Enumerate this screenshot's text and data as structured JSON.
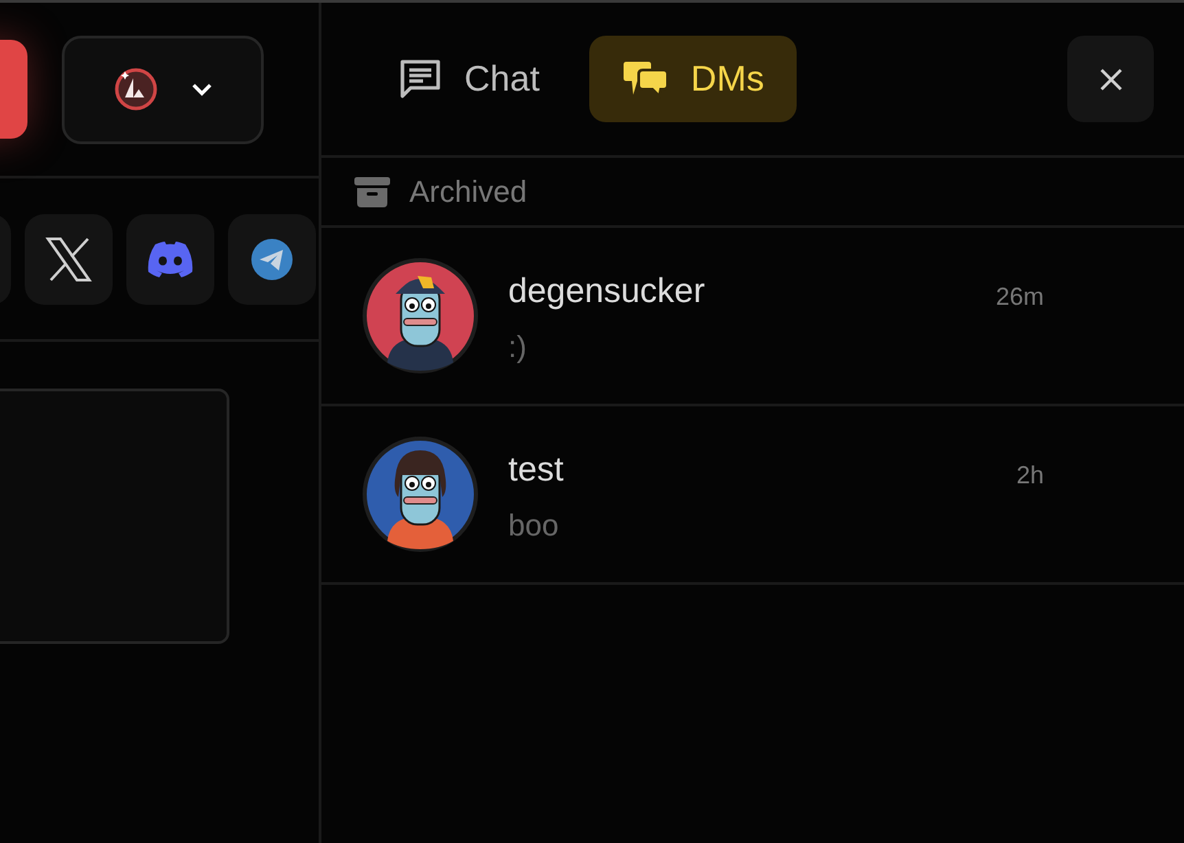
{
  "network_selector": {
    "expanded": false
  },
  "social_links": [
    {
      "kind": "other"
    },
    {
      "kind": "x"
    },
    {
      "kind": "discord"
    },
    {
      "kind": "telegram"
    }
  ],
  "tabs": [
    {
      "label": "Chat",
      "kind": "chat",
      "selected": false
    },
    {
      "label": "DMs",
      "kind": "dms",
      "selected": true
    }
  ],
  "archived": {
    "label": "Archived"
  },
  "conversations": [
    {
      "name": "degensucker",
      "preview": ":)",
      "time": "26m",
      "color": "#d04352",
      "kind": "cap"
    },
    {
      "name": "test",
      "preview": "boo",
      "time": "2h",
      "color": "#2f5dad",
      "kind": "locks"
    }
  ]
}
